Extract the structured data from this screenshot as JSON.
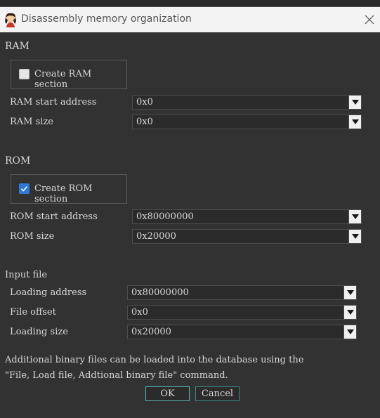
{
  "window": {
    "title": "Disassembly memory organization",
    "close_icon": "close-icon"
  },
  "ram": {
    "section_label": "RAM",
    "create_label": "Create RAM section",
    "create_checked": false,
    "start_label": "RAM start address",
    "start_value": "0x0",
    "size_label": "RAM size",
    "size_value": "0x0"
  },
  "rom": {
    "section_label": "ROM",
    "create_label": "Create ROM section",
    "create_checked": true,
    "start_label": "ROM start address",
    "start_value": "0x80000000",
    "size_label": "ROM size",
    "size_value": "0x20000"
  },
  "input_file": {
    "section_label": "Input file",
    "loading_address_label": "Loading address",
    "loading_address_value": "0x80000000",
    "file_offset_label": "File offset",
    "file_offset_value": "0x0",
    "loading_size_label": "Loading size",
    "loading_size_value": "0x20000"
  },
  "note": {
    "line1": "Additional binary files can be loaded into the database using the",
    "line2": "\"File, Load file, Addtional binary file\" command."
  },
  "buttons": {
    "ok": "OK",
    "cancel": "Cancel"
  },
  "colors": {
    "accent": "#2f78d6",
    "button_border": "#58b3b3",
    "background": "#323232"
  }
}
